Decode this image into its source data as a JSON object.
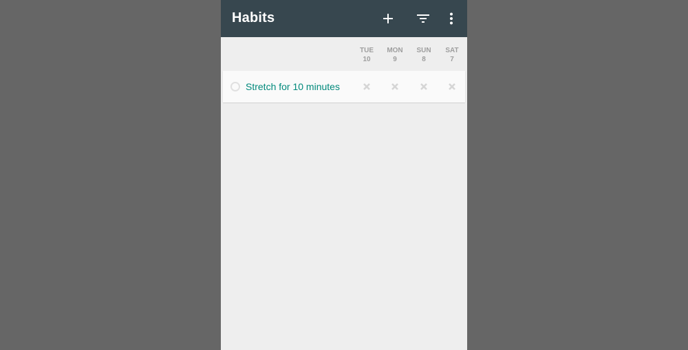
{
  "toolbar": {
    "title": "Habits",
    "background": "#37474f",
    "actions": [
      {
        "icon": "plus-icon",
        "label": "Add habit"
      },
      {
        "icon": "filter-icon",
        "label": "Filter"
      },
      {
        "icon": "more-vert-icon",
        "label": "More options"
      }
    ]
  },
  "days": [
    {
      "weekday": "TUE",
      "date": "10"
    },
    {
      "weekday": "MON",
      "date": "9"
    },
    {
      "weekday": "SUN",
      "date": "8"
    },
    {
      "weekday": "SAT",
      "date": "7"
    }
  ],
  "habits": [
    {
      "name": "Stretch for 10 minutes",
      "color": "#00897b",
      "checkmarks": [
        "unchecked",
        "unchecked",
        "unchecked",
        "unchecked"
      ]
    }
  ]
}
